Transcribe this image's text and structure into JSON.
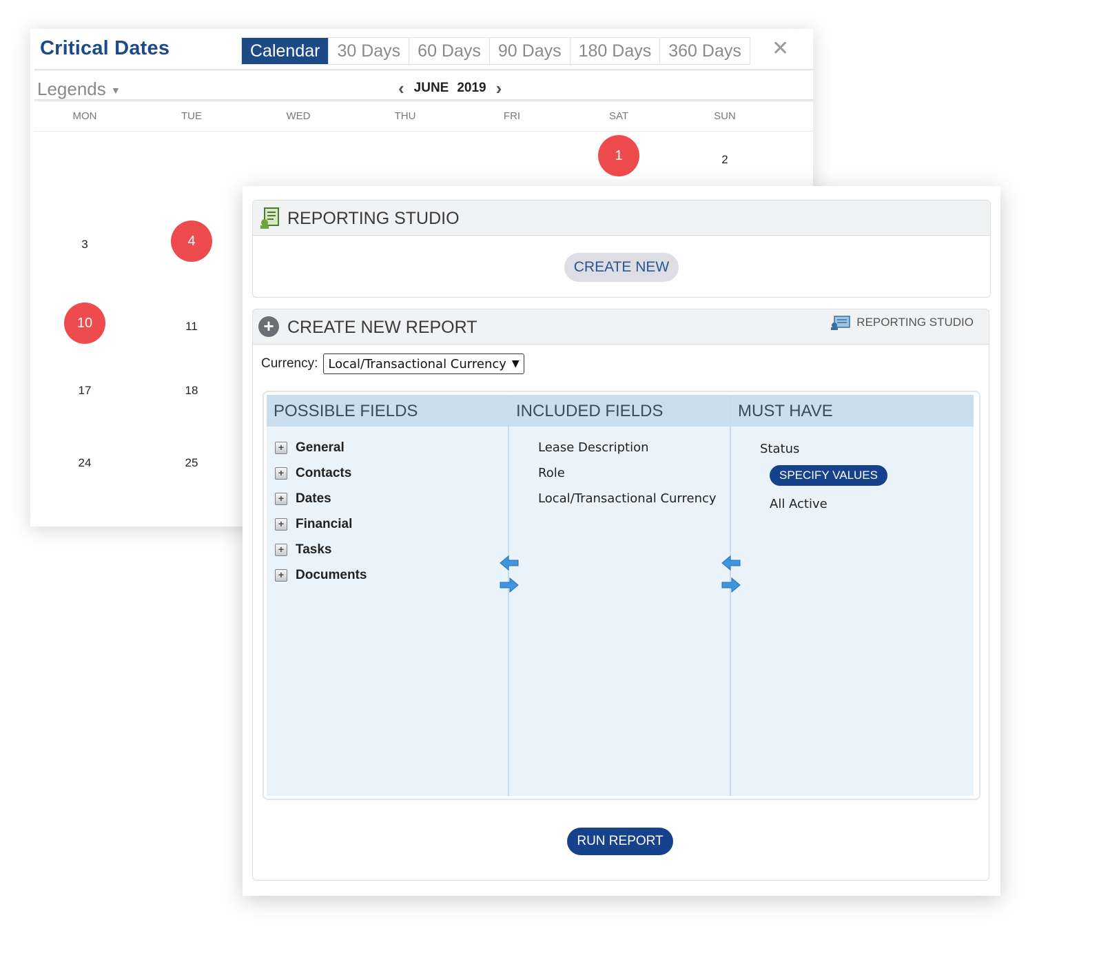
{
  "calendar": {
    "title": "Critical Dates",
    "tabs": [
      {
        "label": "Calendar",
        "active": true
      },
      {
        "label": "30 Days",
        "active": false
      },
      {
        "label": "60 Days",
        "active": false
      },
      {
        "label": "90 Days",
        "active": false
      },
      {
        "label": "180 Days",
        "active": false
      },
      {
        "label": "360 Days",
        "active": false
      }
    ],
    "close_icon": "close-icon",
    "legends_label": "Legends",
    "month": "JUNE",
    "year": "2019",
    "weekdays": [
      "MON",
      "TUE",
      "WED",
      "THU",
      "FRI",
      "SAT",
      "SUN"
    ],
    "days": [
      {
        "label": "1",
        "marked": true
      },
      {
        "label": "2",
        "marked": false
      },
      {
        "label": "3",
        "marked": false
      },
      {
        "label": "4",
        "marked": true
      },
      {
        "label": "10",
        "marked": true
      },
      {
        "label": "11",
        "marked": false
      },
      {
        "label": "17",
        "marked": false
      },
      {
        "label": "18",
        "marked": false
      },
      {
        "label": "24",
        "marked": false
      },
      {
        "label": "25",
        "marked": false
      }
    ],
    "marked_color": "#ee4b4f"
  },
  "reporting_studio": {
    "title": "REPORTING STUDIO",
    "create_new_label": "CREATE NEW",
    "report": {
      "title": "CREATE NEW REPORT",
      "link_label": "REPORTING STUDIO",
      "currency_label": "Currency:",
      "currency_value": "Local/Transactional Currency",
      "columns": {
        "possible": "POSSIBLE FIELDS",
        "included": "INCLUDED FIELDS",
        "must": "MUST HAVE"
      },
      "possible_fields": [
        "General",
        "Contacts",
        "Dates",
        "Financial",
        "Tasks",
        "Documents"
      ],
      "included_fields": [
        "Lease Description",
        "Role",
        "Local/Transactional Currency"
      ],
      "must_have": {
        "field": "Status",
        "specify_values_label": "SPECIFY VALUES",
        "value": "All Active"
      },
      "run_report_label": "RUN REPORT"
    },
    "accent_color": "#15428a",
    "panel_color": "#eaf3fa"
  }
}
